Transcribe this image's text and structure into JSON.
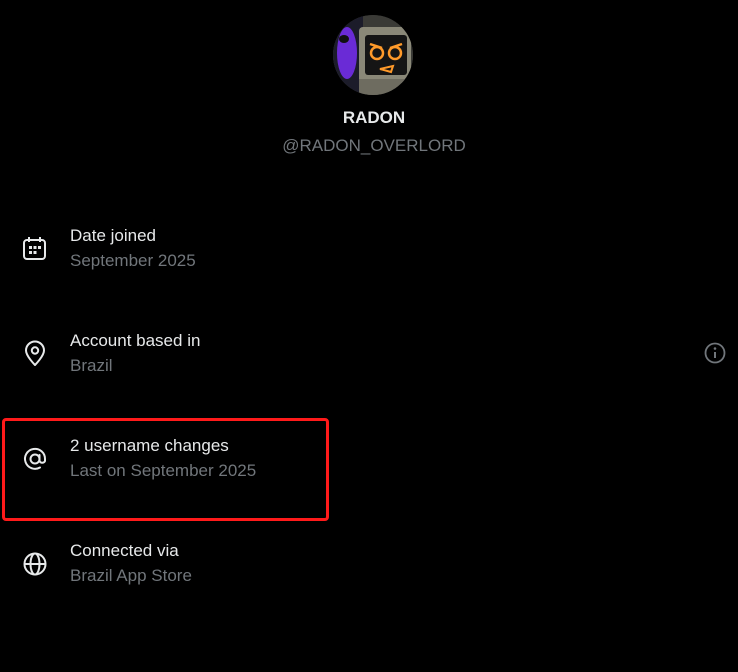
{
  "profile": {
    "display_name": "RADON",
    "handle": "@RADON_OVERLORD"
  },
  "about_items": [
    {
      "icon": "calendar-icon",
      "title": "Date joined",
      "subtitle": "September 2025"
    },
    {
      "icon": "location-pin-icon",
      "title": "Account based in",
      "subtitle": "Brazil"
    },
    {
      "icon": "at-sign-icon",
      "title": "2 username changes",
      "subtitle": "Last on September 2025"
    },
    {
      "icon": "globe-icon",
      "title": "Connected via",
      "subtitle": "Brazil App Store"
    }
  ],
  "colors": {
    "background": "#000000",
    "primary_text": "#e7e9ea",
    "secondary_text": "#71767b",
    "highlight_border": "#ff1a1a"
  }
}
